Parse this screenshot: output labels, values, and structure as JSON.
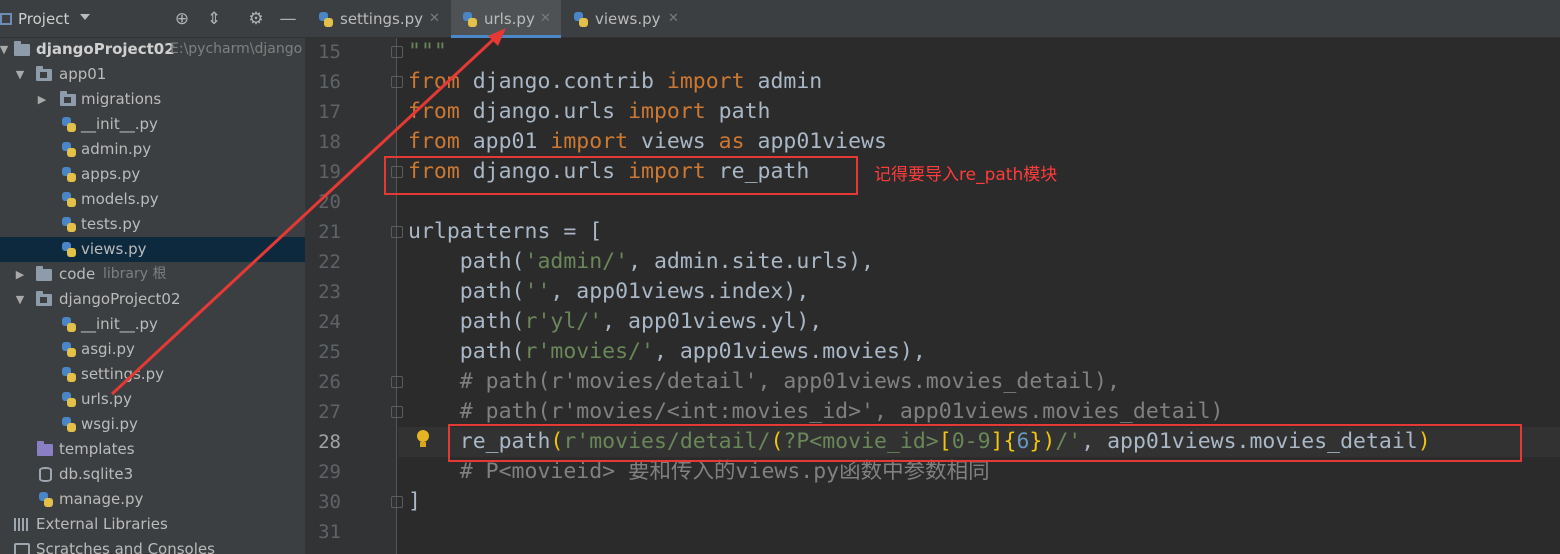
{
  "project_panel": {
    "title": "Project",
    "tree": [
      {
        "label": "djangoProject02",
        "hint": "E:\\pycharm\\django",
        "kind": "root"
      },
      {
        "label": "app01",
        "kind": "module"
      },
      {
        "label": "migrations",
        "kind": "folder"
      },
      {
        "label": "__init__.py",
        "kind": "py"
      },
      {
        "label": "admin.py",
        "kind": "py"
      },
      {
        "label": "apps.py",
        "kind": "py"
      },
      {
        "label": "models.py",
        "kind": "py"
      },
      {
        "label": "tests.py",
        "kind": "py"
      },
      {
        "label": "views.py",
        "kind": "py",
        "selected": true
      },
      {
        "label": "code",
        "hint": "library 根",
        "kind": "folder"
      },
      {
        "label": "djangoProject02",
        "kind": "module"
      },
      {
        "label": "__init__.py",
        "kind": "py"
      },
      {
        "label": "asgi.py",
        "kind": "py"
      },
      {
        "label": "settings.py",
        "kind": "py"
      },
      {
        "label": "urls.py",
        "kind": "py"
      },
      {
        "label": "wsgi.py",
        "kind": "py"
      },
      {
        "label": "templates",
        "kind": "templates"
      },
      {
        "label": "db.sqlite3",
        "kind": "db"
      },
      {
        "label": "manage.py",
        "kind": "py"
      },
      {
        "label": "External Libraries",
        "kind": "libs"
      },
      {
        "label": "Scratches and Consoles",
        "kind": "scratches"
      }
    ]
  },
  "tabs": [
    {
      "label": "settings.py",
      "active": false
    },
    {
      "label": "urls.py",
      "active": true
    },
    {
      "label": "views.py",
      "active": false
    }
  ],
  "editor": {
    "line_numbers": [
      "15",
      "16",
      "17",
      "18",
      "19",
      "20",
      "21",
      "22",
      "23",
      "24",
      "25",
      "26",
      "27",
      "28",
      "29",
      "30",
      "31"
    ],
    "current_line": "28",
    "annotation": "记得要导入re_path模块",
    "code": {
      "l15": "\"\"\"",
      "l16_from": "from",
      "l16_mod": " django.contrib ",
      "l16_imp": "import",
      "l16_name": " admin",
      "l17_from": "from",
      "l17_mod": " django.urls ",
      "l17_imp": "import",
      "l17_name": " path",
      "l18_from": "from",
      "l18_mod": " app01 ",
      "l18_imp": "import",
      "l18_name": " views ",
      "l18_as": "as",
      "l18_alias": " app01views",
      "l19_from": "from",
      "l19_mod": " django.urls ",
      "l19_imp": "import",
      "l19_name": " re_path",
      "l21": "urlpatterns = [",
      "l22_a": "    path(",
      "l22_s": "'admin/'",
      "l22_b": ", admin.site.urls),",
      "l23_a": "    path(",
      "l23_s": "''",
      "l23_b": ", app01views.index),",
      "l24_a": "    path(",
      "l24_s": "r'yl/'",
      "l24_b": ", app01views.yl),",
      "l25_a": "    path(",
      "l25_s": "r'movies/'",
      "l25_b": ", app01views.movies),",
      "l26": "    # path(r'movies/detail', app01views.movies_detail),",
      "l27": "    # path(r'movies/<int:movies_id>', app01views.movies_detail)",
      "l28_a": "    re_path",
      "l28_p1": "(",
      "l28_s1": "r'movies/detail/",
      "l28_p2": "(",
      "l28_s2": "?P<movie_id>",
      "l28_br1": "[",
      "l28_range": "0-9",
      "l28_br2": "]",
      "l28_cb1": "{",
      "l28_n": "6",
      "l28_cb2": "}",
      "l28_p3": ")",
      "l28_s3": "/'",
      "l28_b": ", app01views.movies_detail",
      "l28_p4": ")",
      "l29": "    # P<movieid> 要和传入的views.py函数中参数相同",
      "l30": "]"
    }
  },
  "colors": {
    "keyword": "#cc7832",
    "string": "#6a8759",
    "comment": "#808080",
    "number": "#6897bb",
    "annotation_red": "#e53935"
  }
}
